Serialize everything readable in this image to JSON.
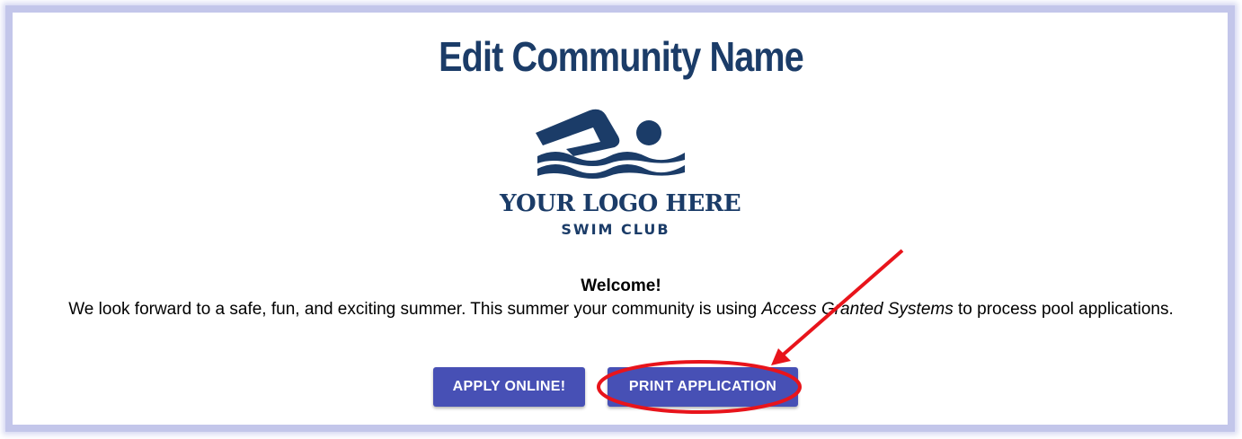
{
  "page": {
    "title": "Edit Community Name"
  },
  "logo": {
    "line1": "YOUR LOGO HERE",
    "line2": "SWIM CLUB",
    "icon": "swimmer-icon",
    "color": "#1b3c68"
  },
  "content": {
    "welcome": "Welcome!",
    "message_before": "We look forward to a safe, fun, and exciting summer. This summer your community is using ",
    "message_italic": "Access Granted Systems",
    "message_after": " to process pool applications."
  },
  "buttons": {
    "apply_label": "APPLY ONLINE!",
    "print_label": "PRINT APPLICATION",
    "color": "#4750b5"
  },
  "annotation": {
    "color": "#e8141b",
    "shape": "red circle and arrow highlighting print button"
  }
}
